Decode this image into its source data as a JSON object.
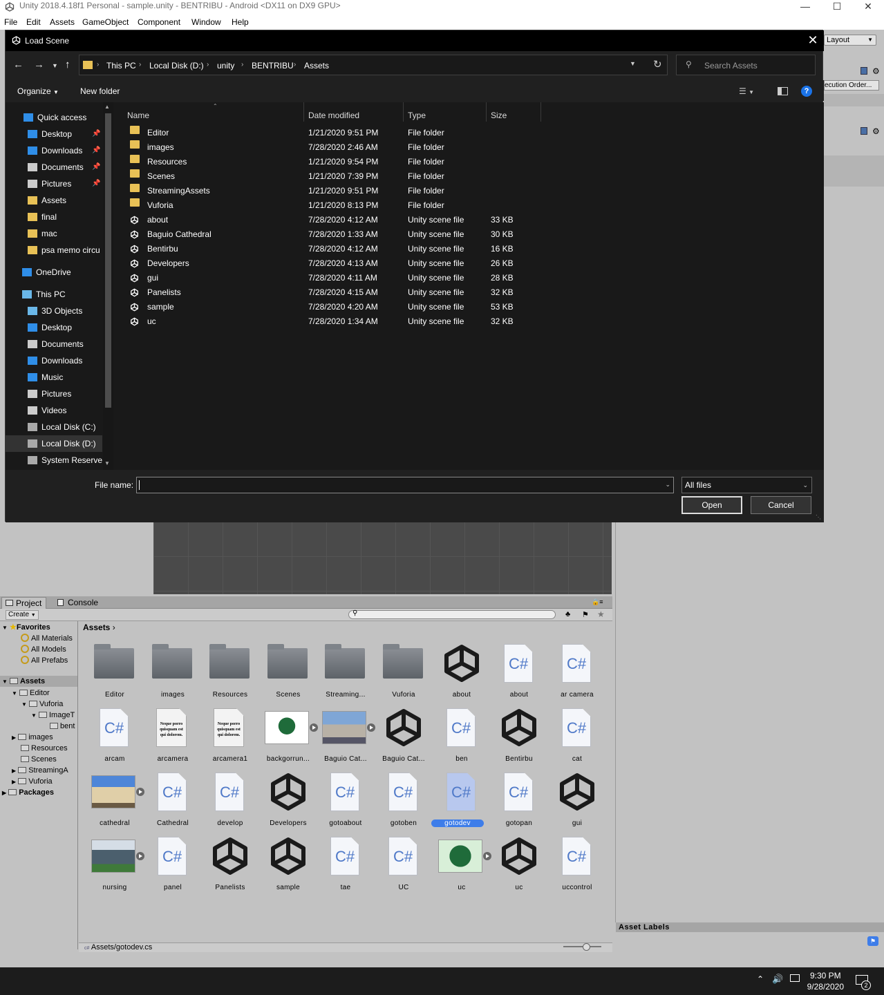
{
  "unity": {
    "title": "Unity 2018.4.18f1 Personal - sample.unity - BENTRIBU - Android <DX11 on DX9 GPU>",
    "menu": [
      "File",
      "Edit",
      "Assets",
      "GameObject",
      "Component",
      "Window",
      "Help"
    ],
    "layout_label": "Layout",
    "exec_order_label": "ecution Order..."
  },
  "dialog": {
    "title": "Load Scene",
    "breadcrumb": [
      "This PC",
      "Local Disk (D:)",
      "unity",
      "BENTRIBU",
      "Assets"
    ],
    "search_placeholder": "Search Assets",
    "organize_label": "Organize",
    "new_folder_label": "New folder",
    "nav": {
      "quick_access": "Quick access",
      "quick_items": [
        {
          "label": "Desktop",
          "pinned": true
        },
        {
          "label": "Downloads",
          "pinned": true
        },
        {
          "label": "Documents",
          "pinned": true
        },
        {
          "label": "Pictures",
          "pinned": true
        },
        {
          "label": "Assets",
          "pinned": false
        },
        {
          "label": "final",
          "pinned": false
        },
        {
          "label": "mac",
          "pinned": false
        },
        {
          "label": "psa memo circu",
          "pinned": false
        }
      ],
      "onedrive": "OneDrive",
      "this_pc": "This PC",
      "pc_items": [
        "3D Objects",
        "Desktop",
        "Documents",
        "Downloads",
        "Music",
        "Pictures",
        "Videos",
        "Local Disk (C:)",
        "Local Disk (D:)",
        "System Reservec"
      ]
    },
    "columns": {
      "name": "Name",
      "date": "Date modified",
      "type": "Type",
      "size": "Size"
    },
    "files": [
      {
        "name": "Editor",
        "date": "1/21/2020 9:51 PM",
        "type": "File folder",
        "size": "",
        "kind": "folder"
      },
      {
        "name": "images",
        "date": "7/28/2020 2:46 AM",
        "type": "File folder",
        "size": "",
        "kind": "folder"
      },
      {
        "name": "Resources",
        "date": "1/21/2020 9:54 PM",
        "type": "File folder",
        "size": "",
        "kind": "folder"
      },
      {
        "name": "Scenes",
        "date": "1/21/2020 7:39 PM",
        "type": "File folder",
        "size": "",
        "kind": "folder"
      },
      {
        "name": "StreamingAssets",
        "date": "1/21/2020 9:51 PM",
        "type": "File folder",
        "size": "",
        "kind": "folder"
      },
      {
        "name": "Vuforia",
        "date": "1/21/2020 8:13 PM",
        "type": "File folder",
        "size": "",
        "kind": "folder"
      },
      {
        "name": "about",
        "date": "7/28/2020 4:12 AM",
        "type": "Unity scene file",
        "size": "33 KB",
        "kind": "unity"
      },
      {
        "name": "Baguio Cathedral",
        "date": "7/28/2020 1:33 AM",
        "type": "Unity scene file",
        "size": "30 KB",
        "kind": "unity"
      },
      {
        "name": "Bentirbu",
        "date": "7/28/2020 4:12 AM",
        "type": "Unity scene file",
        "size": "16 KB",
        "kind": "unity"
      },
      {
        "name": "Developers",
        "date": "7/28/2020 4:13 AM",
        "type": "Unity scene file",
        "size": "26 KB",
        "kind": "unity"
      },
      {
        "name": "gui",
        "date": "7/28/2020 4:11 AM",
        "type": "Unity scene file",
        "size": "28 KB",
        "kind": "unity"
      },
      {
        "name": "Panelists",
        "date": "7/28/2020 4:15 AM",
        "type": "Unity scene file",
        "size": "32 KB",
        "kind": "unity"
      },
      {
        "name": "sample",
        "date": "7/28/2020 4:20 AM",
        "type": "Unity scene file",
        "size": "53 KB",
        "kind": "unity"
      },
      {
        "name": "uc",
        "date": "7/28/2020 1:34 AM",
        "type": "Unity scene file",
        "size": "32 KB",
        "kind": "unity"
      }
    ],
    "file_name_label": "File name:",
    "file_name_value": "",
    "file_type": "All files",
    "open_label": "Open",
    "cancel_label": "Cancel"
  },
  "project": {
    "tabs": [
      "Project",
      "Console"
    ],
    "create_label": "Create",
    "tree": {
      "favorites": "Favorites",
      "fav_items": [
        "All Materials",
        "All Models",
        "All Prefabs"
      ],
      "assets": "Assets",
      "items": [
        {
          "label": "Editor",
          "depth": 1
        },
        {
          "label": "Vuforia",
          "depth": 2
        },
        {
          "label": "ImageT",
          "depth": 3
        },
        {
          "label": "bent",
          "depth": 4
        },
        {
          "label": "images",
          "depth": 1
        },
        {
          "label": "Resources",
          "depth": 1
        },
        {
          "label": "Scenes",
          "depth": 1
        },
        {
          "label": "StreamingA",
          "depth": 1
        },
        {
          "label": "Vuforia",
          "depth": 1
        }
      ],
      "packages": "Packages"
    },
    "crumb": "Assets",
    "assets": [
      {
        "label": "Editor",
        "kind": "folder"
      },
      {
        "label": "images",
        "kind": "folder"
      },
      {
        "label": "Resources",
        "kind": "folder"
      },
      {
        "label": "Scenes",
        "kind": "folder"
      },
      {
        "label": "Streaming...",
        "kind": "folder"
      },
      {
        "label": "Vuforia",
        "kind": "folder"
      },
      {
        "label": "about",
        "kind": "unity"
      },
      {
        "label": "about",
        "kind": "cs"
      },
      {
        "label": "ar camera",
        "kind": "cs"
      },
      {
        "label": "arcam",
        "kind": "cs"
      },
      {
        "label": "arcamera",
        "kind": "doc"
      },
      {
        "label": "arcamera1",
        "kind": "doc"
      },
      {
        "label": "backgorrun...",
        "kind": "seal"
      },
      {
        "label": "Baguio Cat...",
        "kind": "photo-church"
      },
      {
        "label": "Baguio Cat...",
        "kind": "unity"
      },
      {
        "label": "ben",
        "kind": "cs"
      },
      {
        "label": "Bentirbu",
        "kind": "unity"
      },
      {
        "label": "cat",
        "kind": "cs"
      },
      {
        "label": "cathedral",
        "kind": "photo-cathedral"
      },
      {
        "label": "Cathedral",
        "kind": "cs"
      },
      {
        "label": "develop",
        "kind": "cs"
      },
      {
        "label": "Developers",
        "kind": "unity"
      },
      {
        "label": "gotoabout",
        "kind": "cs"
      },
      {
        "label": "gotoben",
        "kind": "cs"
      },
      {
        "label": "gotodev",
        "kind": "cs",
        "selected": true
      },
      {
        "label": "gotopan",
        "kind": "cs"
      },
      {
        "label": "gui",
        "kind": "unity"
      },
      {
        "label": "nursing",
        "kind": "photo-building"
      },
      {
        "label": "panel",
        "kind": "cs"
      },
      {
        "label": "Panelists",
        "kind": "unity"
      },
      {
        "label": "sample",
        "kind": "unity"
      },
      {
        "label": "tae",
        "kind": "cs"
      },
      {
        "label": "UC",
        "kind": "cs"
      },
      {
        "label": "uc",
        "kind": "seal-green"
      },
      {
        "label": "uc",
        "kind": "unity"
      },
      {
        "label": "uccontrol",
        "kind": "cs"
      }
    ],
    "doc_text": "Neque porro quisquam est qui dolorem.",
    "path": "Assets/gotodev.cs",
    "asset_labels": "Asset Labels"
  },
  "taskbar": {
    "time": "9:30 PM",
    "date": "9/28/2020",
    "notif_count": "2"
  }
}
